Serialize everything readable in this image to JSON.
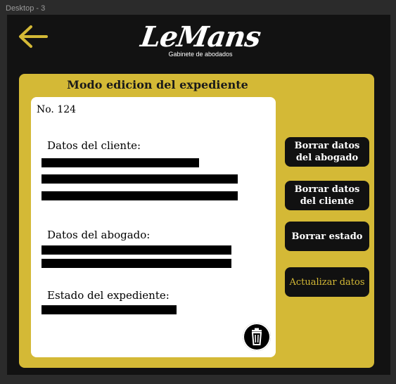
{
  "frame": {
    "label": "Desktop - 3"
  },
  "header": {
    "back_icon": "arrow-left-icon",
    "logo_text": "LeMans",
    "logo_tagline": "Gabinete de abodados"
  },
  "panel": {
    "title": "Modo edicion del expediente",
    "case_number": "No. 124",
    "sections": {
      "client": "Datos del cliente:",
      "lawyer": "Datos del abogado:",
      "status": "Estado del expediente:"
    },
    "trash_icon": "trash-icon"
  },
  "actions": {
    "delete_lawyer": "Borrar datos del abogado",
    "delete_client": "Borrar datos del cliente",
    "delete_status": "Borrar estado",
    "update": "Actualizar datos"
  },
  "colors": {
    "accent": "#d4b936",
    "background": "#121212",
    "card": "#ffffff"
  }
}
